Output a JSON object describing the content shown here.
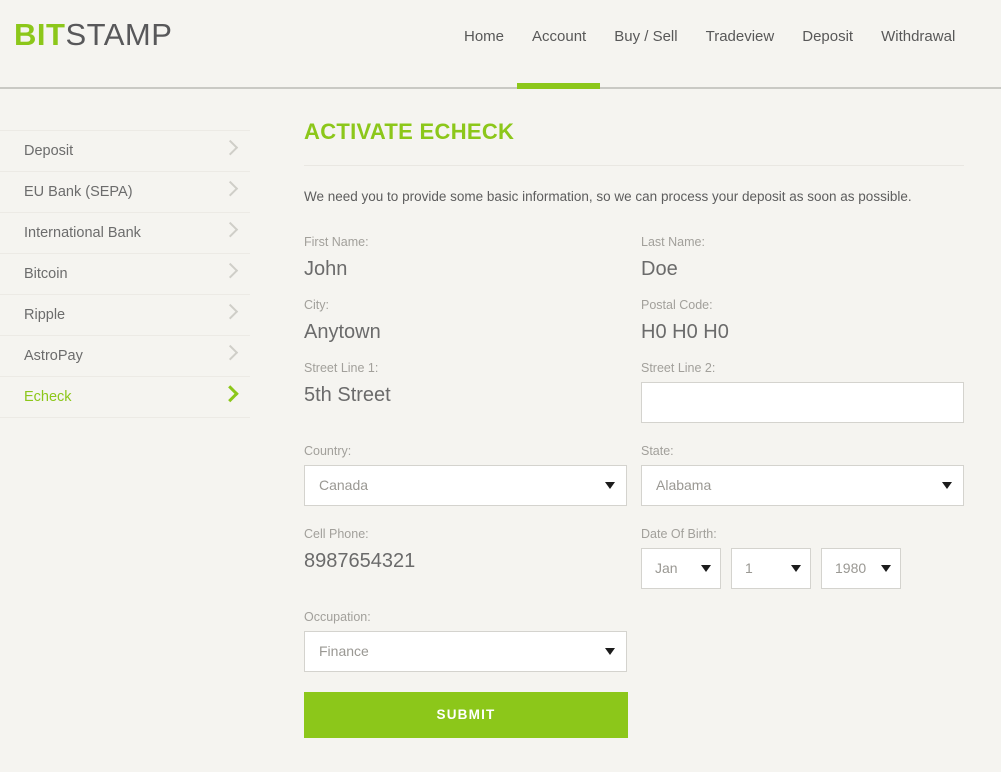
{
  "brand": {
    "logo_bit": "BIT",
    "logo_stamp": "STAMP",
    "accent_green": "#8cc71a",
    "text_gray": "#58585a",
    "background": "#f5f4f0"
  },
  "nav": {
    "items": [
      {
        "label": "Home",
        "active": false
      },
      {
        "label": "Account",
        "active": true
      },
      {
        "label": "Buy / Sell",
        "active": false
      },
      {
        "label": "Tradeview",
        "active": false
      },
      {
        "label": "Deposit",
        "active": false
      },
      {
        "label": "Withdrawal",
        "active": false
      }
    ]
  },
  "sidebar": {
    "items": [
      {
        "label": "Deposit",
        "active": false
      },
      {
        "label": "EU Bank (SEPA)",
        "active": false
      },
      {
        "label": "International Bank",
        "active": false
      },
      {
        "label": "Bitcoin",
        "active": false
      },
      {
        "label": "Ripple",
        "active": false
      },
      {
        "label": "AstroPay",
        "active": false
      },
      {
        "label": "Echeck",
        "active": true
      }
    ]
  },
  "main": {
    "title": "ACTIVATE ECHECK",
    "intro": "We need you to provide some basic information, so we can process your deposit as soon as possible.",
    "fields": {
      "first_name": {
        "label": "First Name:",
        "value": "John"
      },
      "last_name": {
        "label": "Last Name:",
        "value": "Doe"
      },
      "city": {
        "label": "City:",
        "value": "Anytown"
      },
      "postal_code": {
        "label": "Postal Code:",
        "value": "H0 H0 H0"
      },
      "street_line_1": {
        "label": "Street Line 1:",
        "value": "5th Street"
      },
      "street_line_2": {
        "label": "Street Line 2:",
        "value": "",
        "placeholder": ""
      },
      "country": {
        "label": "Country:",
        "value": "Canada"
      },
      "state": {
        "label": "State:",
        "value": "Alabama"
      },
      "cell_phone": {
        "label": "Cell Phone:",
        "value": "8987654321"
      },
      "date_of_birth": {
        "label": "Date Of Birth:",
        "month": "Jan",
        "day": "1",
        "year": "1980"
      },
      "occupation": {
        "label": "Occupation:",
        "value": "Finance"
      }
    },
    "submit_label": "SUBMIT"
  }
}
